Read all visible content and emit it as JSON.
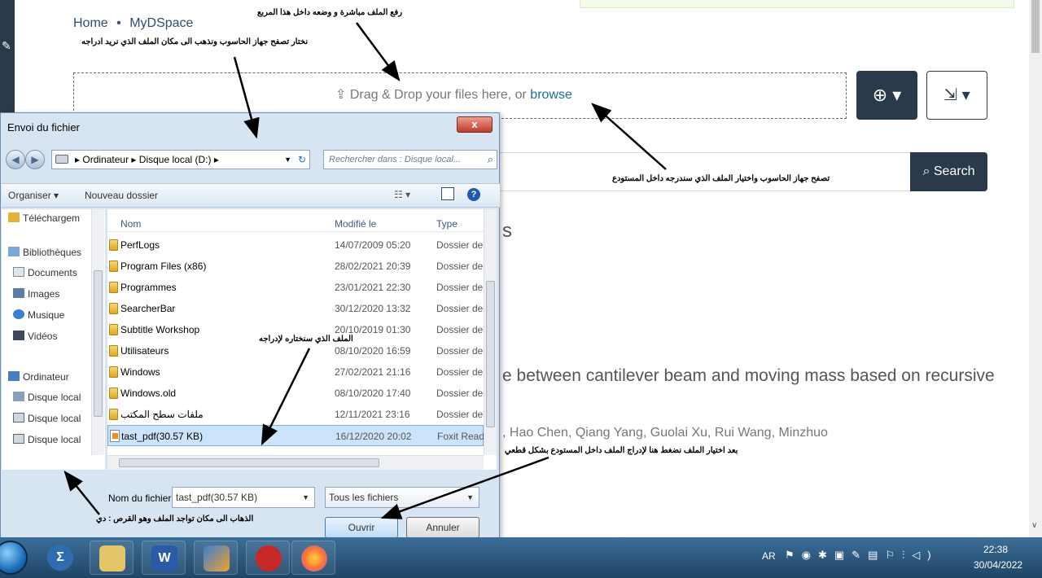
{
  "breadcrumb": {
    "home": "Home",
    "separator": "•",
    "current": "MyDSpace"
  },
  "dropzone": {
    "text": "Drag & Drop your files here, or",
    "browse_link": "browse"
  },
  "search": {
    "button_label": "Search"
  },
  "page_fragments": {
    "heading_fragment": "s",
    "item_title": "e between cantilever beam and moving mass based on recursive",
    "item_authors": ", Hao Chen, Qiang Yang, Guolai Xu, Rui Wang, Minzhuo"
  },
  "annotations": {
    "top": "رفع الملف مباشرة  و وضعه داخل هذا المربع",
    "browse_pc": "نختار تصفح  جهاز الحاسوب ونذهب الى مكان الملف الذي نريد ادراجه",
    "browse_select": "تصفح  جهاز الحاسوب واختيار الملف الذي سندرجه داخل المستودع",
    "chosen_file": "الملف الذي سنختاره لإدراجه",
    "open_hint": "بعد اختيار الملف نضغط هنا لإدراج الملف داخل المستودع بشكل قطعي",
    "drive_hint": "الذهاب الى مكان تواجد الملف وهو القرص : دي"
  },
  "dialog": {
    "title": "Envoi du fichier",
    "close": "x",
    "address": {
      "parts": [
        "Ordinateur",
        "Disque local (D:)"
      ],
      "separator": "▸"
    },
    "search_placeholder": "Rechercher dans : Disque local...",
    "toolbar": {
      "organize": "Organiser ▾",
      "new_folder": "Nouveau dossier"
    },
    "nav_items": [
      "Téléchargem",
      "Bibliothèques",
      "Documents",
      "Images",
      "Musique",
      "Vidéos",
      "Ordinateur",
      "Disque local",
      "Disque local",
      "Disque local"
    ],
    "columns": {
      "name": "Nom",
      "modified": "Modifié le",
      "type": "Type"
    },
    "files": [
      {
        "name": "PerfLogs",
        "date": "14/07/2009 05:20",
        "type": "Dossier de",
        "icon": "folder-icon"
      },
      {
        "name": "Program Files (x86)",
        "date": "28/02/2021 20:39",
        "type": "Dossier de",
        "icon": "folder-icon"
      },
      {
        "name": "Programmes",
        "date": "23/01/2021 22:30",
        "type": "Dossier de",
        "icon": "folder-icon"
      },
      {
        "name": "SearcherBar",
        "date": "30/12/2020 13:32",
        "type": "Dossier de",
        "icon": "folder-icon"
      },
      {
        "name": "Subtitle Workshop",
        "date": "20/10/2019 01:30",
        "type": "Dossier de",
        "icon": "folder-icon"
      },
      {
        "name": "Utilisateurs",
        "date": "08/10/2020 16:59",
        "type": "Dossier de",
        "icon": "folder-icon"
      },
      {
        "name": "Windows",
        "date": "27/02/2021 21:16",
        "type": "Dossier de",
        "icon": "folder-icon"
      },
      {
        "name": "Windows.old",
        "date": "08/10/2020 17:40",
        "type": "Dossier de",
        "icon": "folder-icon"
      },
      {
        "name": "ملفات سطح المكتب",
        "date": "12/11/2021 23:16",
        "type": "Dossier de",
        "icon": "folder-icon"
      },
      {
        "name": "tast_pdf(30.57 KB)",
        "date": "16/12/2020 20:02",
        "type": "Foxit Read",
        "icon": "pdf-file-icon",
        "selected": true
      }
    ],
    "filename_label": "Nom du fichier :",
    "filename_value": "tast_pdf(30.57 KB)",
    "filetype_value": "Tous les fichiers",
    "open_button": "Ouvrir",
    "cancel_button": "Annuler"
  },
  "taskbar": {
    "apps": [
      "sigma-app-icon",
      "file-explorer-icon",
      "word-icon",
      "pdf-editor-icon",
      "red-app-icon",
      "firefox-icon"
    ],
    "word_glyph": "W",
    "sigma_glyph": "Σ",
    "language": "AR",
    "time": "22:38",
    "date": "30/04/2022"
  },
  "colors": {
    "navbar": "#2b3a4a",
    "link": "#1f6d97",
    "selection": "#cce4fb",
    "taskbar": "#2a5880"
  }
}
